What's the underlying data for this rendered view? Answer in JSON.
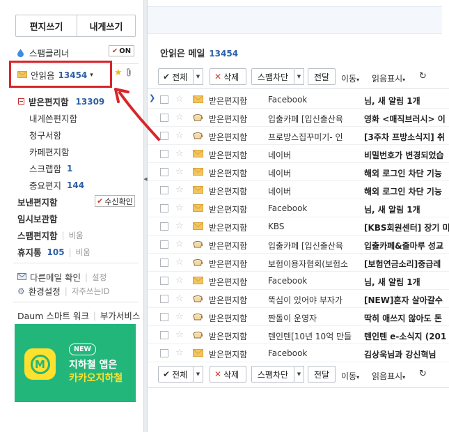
{
  "sidebar": {
    "write_label": "편지쓰기",
    "self_label": "내게쓰기",
    "spam_cleaner": {
      "label": "스팸클리너",
      "toggle": "ON"
    },
    "unread": {
      "label": "안읽음",
      "count": "13454",
      "caret": "▾"
    },
    "inbox": {
      "label": "받은편지함",
      "count": "13309"
    },
    "subfolders": [
      {
        "label": "내게쓴편지함",
        "count": ""
      },
      {
        "label": "청구서함",
        "count": ""
      },
      {
        "label": "카페편지함",
        "count": ""
      },
      {
        "label": "스크랩함",
        "count": "1"
      },
      {
        "label": "중요편지",
        "count": "144"
      }
    ],
    "sent": {
      "label": "보낸편지함",
      "receipt": "수신확인"
    },
    "drafts": {
      "label": "임시보관함"
    },
    "spam": {
      "label": "스팸편지함",
      "note": "비움"
    },
    "trash": {
      "label": "휴지통",
      "count": "105",
      "note": "비움"
    },
    "other_mail": {
      "label": "다른메일 확인",
      "link": "설정"
    },
    "settings": {
      "label": "환경설정",
      "link": "자주쓰는ID"
    },
    "footer_links": [
      "Daum 스마트 워크",
      "부가서비스"
    ],
    "banner": {
      "badge": "NEW",
      "line1": "지하철 앱은",
      "line2": "카카오지하철",
      "logo_letter": "M"
    }
  },
  "main": {
    "title": "안읽은 메일",
    "count": "13454",
    "toolbar": {
      "all": "전체",
      "delete": "삭제",
      "block_spam": "스팸차단",
      "forward": "전달",
      "move": "이동",
      "mark_read": "읽음표시",
      "refresh_icon": "refresh-icon"
    },
    "rows": [
      {
        "icon": "envelope",
        "folder": "받은편지함",
        "sender": "Facebook",
        "subject": "님, 새 알림 1개",
        "blur_sender": false,
        "pointer": true
      },
      {
        "icon": "cup",
        "folder": "받은편지함",
        "sender": "입출카페 [입신출산육",
        "subject": "영화 <매직브러시> 이",
        "blur_sender": false,
        "pointer": false
      },
      {
        "icon": "cup",
        "folder": "받은편지함",
        "sender": "프로방스집꾸미기- 인",
        "subject": "[3주차 프방소식지] 취",
        "blur_sender": false,
        "pointer": false
      },
      {
        "icon": "envelope",
        "folder": "받은편지함",
        "sender": "네이버",
        "subject": "비밀번호가 변경되었습",
        "blur_sender": false,
        "pointer": false
      },
      {
        "icon": "envelope",
        "folder": "받은편지함",
        "sender": "네이버",
        "subject": "해외 로그인 차단 기능",
        "blur_sender": false,
        "pointer": false
      },
      {
        "icon": "envelope",
        "folder": "받은편지함",
        "sender": "네이버",
        "subject": "해외 로그인 차단 기능",
        "blur_sender": false,
        "pointer": false
      },
      {
        "icon": "envelope",
        "folder": "받은편지함",
        "sender": "Facebook",
        "subject": "님, 새 알림 1개",
        "blur_sender": false,
        "pointer": false
      },
      {
        "icon": "envelope",
        "folder": "받은편지함",
        "sender": "KBS",
        "subject": "[KBS회원센터] 장기 미",
        "blur_sender": false,
        "pointer": false
      },
      {
        "icon": "cup",
        "folder": "받은편지함",
        "sender": "입출카페 [입신출산육",
        "subject": "입출카페&줄마루 성교",
        "blur_sender": false,
        "pointer": false
      },
      {
        "icon": "cup",
        "folder": "받은편지함",
        "sender": "보험이용자협회(보험소",
        "subject": "[보험연금소리]중급레",
        "blur_sender": false,
        "pointer": false
      },
      {
        "icon": "envelope",
        "folder": "받은편지함",
        "sender": "Facebook",
        "subject": "님, 새 알림 1개",
        "blur_sender": false,
        "pointer": false
      },
      {
        "icon": "cup",
        "folder": "받은편지함",
        "sender": "뚝심이 있어야 부자가",
        "subject": "[NEW]혼자 살아갈수",
        "blur_sender": false,
        "pointer": false
      },
      {
        "icon": "cup",
        "folder": "받은편지함",
        "sender": "짠돌이 운영자",
        "subject": "딱히 애쓰지 않아도 돈",
        "blur_sender": false,
        "pointer": false
      },
      {
        "icon": "cup",
        "folder": "받은편지함",
        "sender": "텐인텐[10년 10억 만들",
        "subject": "텐인텐 e-소식지 (201",
        "blur_sender": false,
        "pointer": false
      },
      {
        "icon": "envelope",
        "folder": "받은편지함",
        "sender": "Facebook",
        "subject": "김상욱님과 강신혁님",
        "blur_sender": false,
        "pointer": false
      }
    ]
  },
  "colors": {
    "accent_red": "#d8252a",
    "link_blue": "#2d5fa8",
    "banner_green": "#23b67b",
    "banner_yellow": "#fde12e"
  }
}
